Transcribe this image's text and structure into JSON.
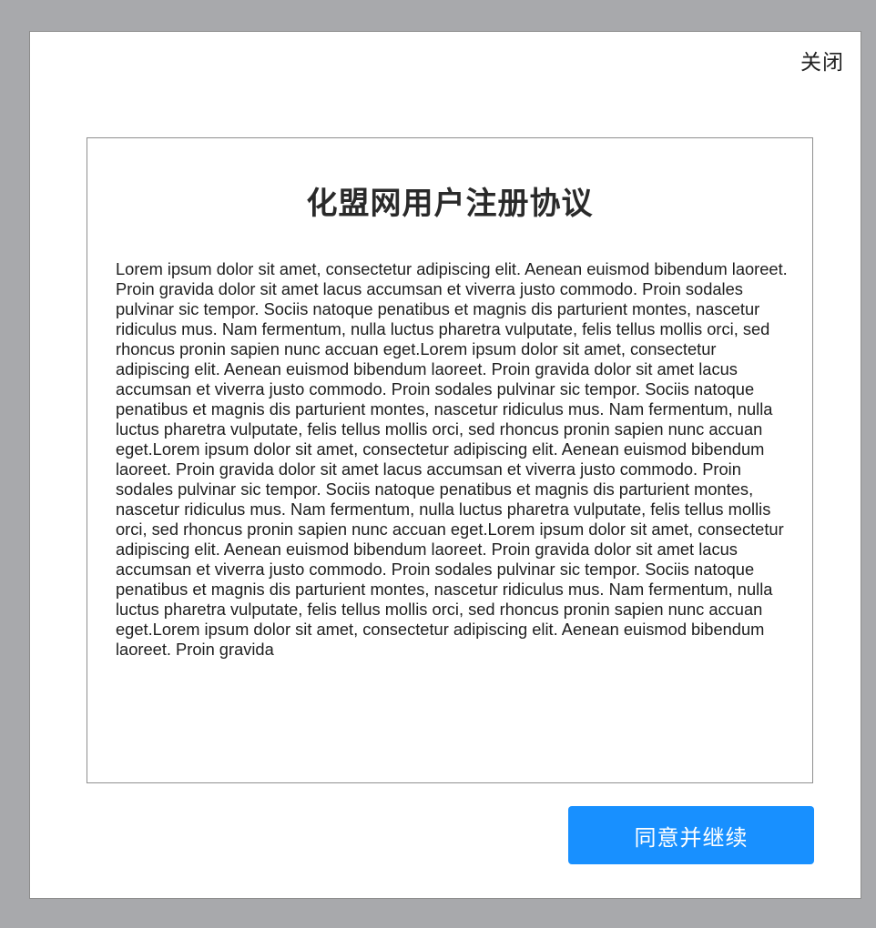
{
  "dialog": {
    "close_label": "关闭",
    "title": "化盟网用户注册协议",
    "body": "Lorem ipsum dolor sit amet, consectetur adipiscing elit. Aenean euismod bibendum laoreet. Proin gravida dolor sit amet lacus accumsan et viverra justo commodo. Proin sodales pulvinar sic tempor. Sociis natoque penatibus et magnis dis parturient montes, nascetur ridiculus mus. Nam fermentum, nulla luctus pharetra vulputate, felis tellus mollis orci, sed rhoncus pronin sapien nunc accuan eget.Lorem ipsum dolor sit amet, consectetur adipiscing elit. Aenean euismod bibendum laoreet. Proin gravida dolor sit amet lacus accumsan et viverra justo commodo. Proin sodales pulvinar sic tempor. Sociis natoque penatibus et magnis dis parturient montes, nascetur ridiculus mus. Nam fermentum, nulla luctus pharetra vulputate, felis tellus mollis orci, sed rhoncus pronin sapien nunc accuan eget.Lorem ipsum dolor sit amet, consectetur adipiscing elit. Aenean euismod bibendum laoreet. Proin gravida dolor sit amet lacus accumsan et viverra justo commodo. Proin sodales pulvinar sic tempor. Sociis natoque penatibus et magnis dis parturient montes, nascetur ridiculus mus. Nam fermentum, nulla luctus pharetra vulputate, felis tellus mollis orci, sed rhoncus pronin sapien nunc accuan eget.Lorem ipsum dolor sit amet, consectetur adipiscing elit. Aenean euismod bibendum laoreet. Proin gravida dolor sit amet lacus accumsan et viverra justo commodo. Proin sodales pulvinar sic tempor. Sociis natoque penatibus et magnis dis parturient montes, nascetur ridiculus mus. Nam fermentum, nulla luctus pharetra vulputate, felis tellus mollis orci, sed rhoncus pronin sapien nunc accuan eget.Lorem ipsum dolor sit amet, consectetur adipiscing elit. Aenean euismod bibendum laoreet. Proin gravida",
    "agree_label": "同意并继续"
  },
  "colors": {
    "overlay": "#a8a9ac",
    "primary": "#1890ff",
    "text": "#1e1e1e"
  }
}
